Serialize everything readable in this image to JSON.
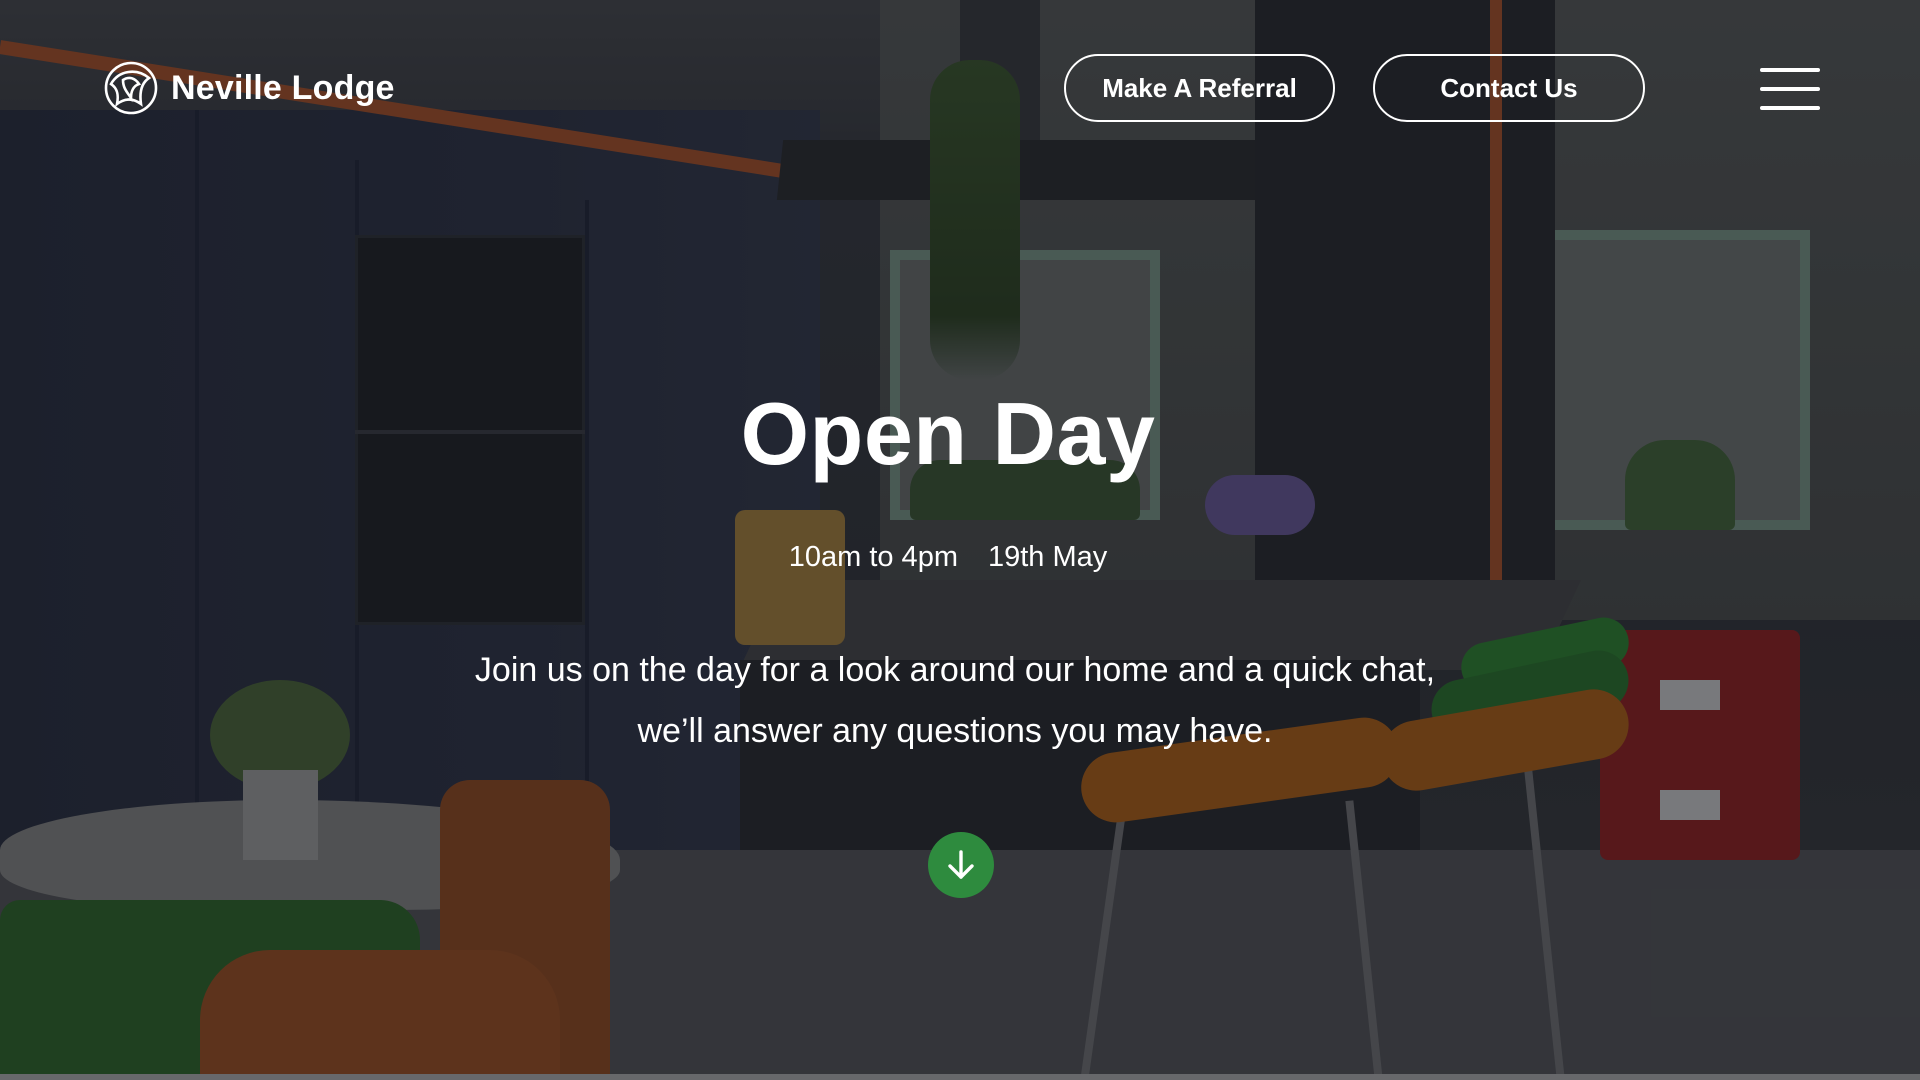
{
  "header": {
    "brand_name": "Neville Lodge",
    "referral_button": "Make A Referral",
    "contact_button": "Contact Us"
  },
  "hero": {
    "title": "Open Day",
    "time": "10am to 4pm",
    "date": "19th May",
    "description_line1": "Join us on the day for a look around our home and a quick chat,",
    "description_line2": "we’ll answer any questions you may have."
  },
  "icons": {
    "logo": "neville-lodge-logo-icon",
    "menu": "hamburger-menu-icon",
    "scroll": "arrow-down-icon"
  },
  "colors": {
    "scroll_button": "#2e8b3e",
    "text": "#ffffff"
  }
}
